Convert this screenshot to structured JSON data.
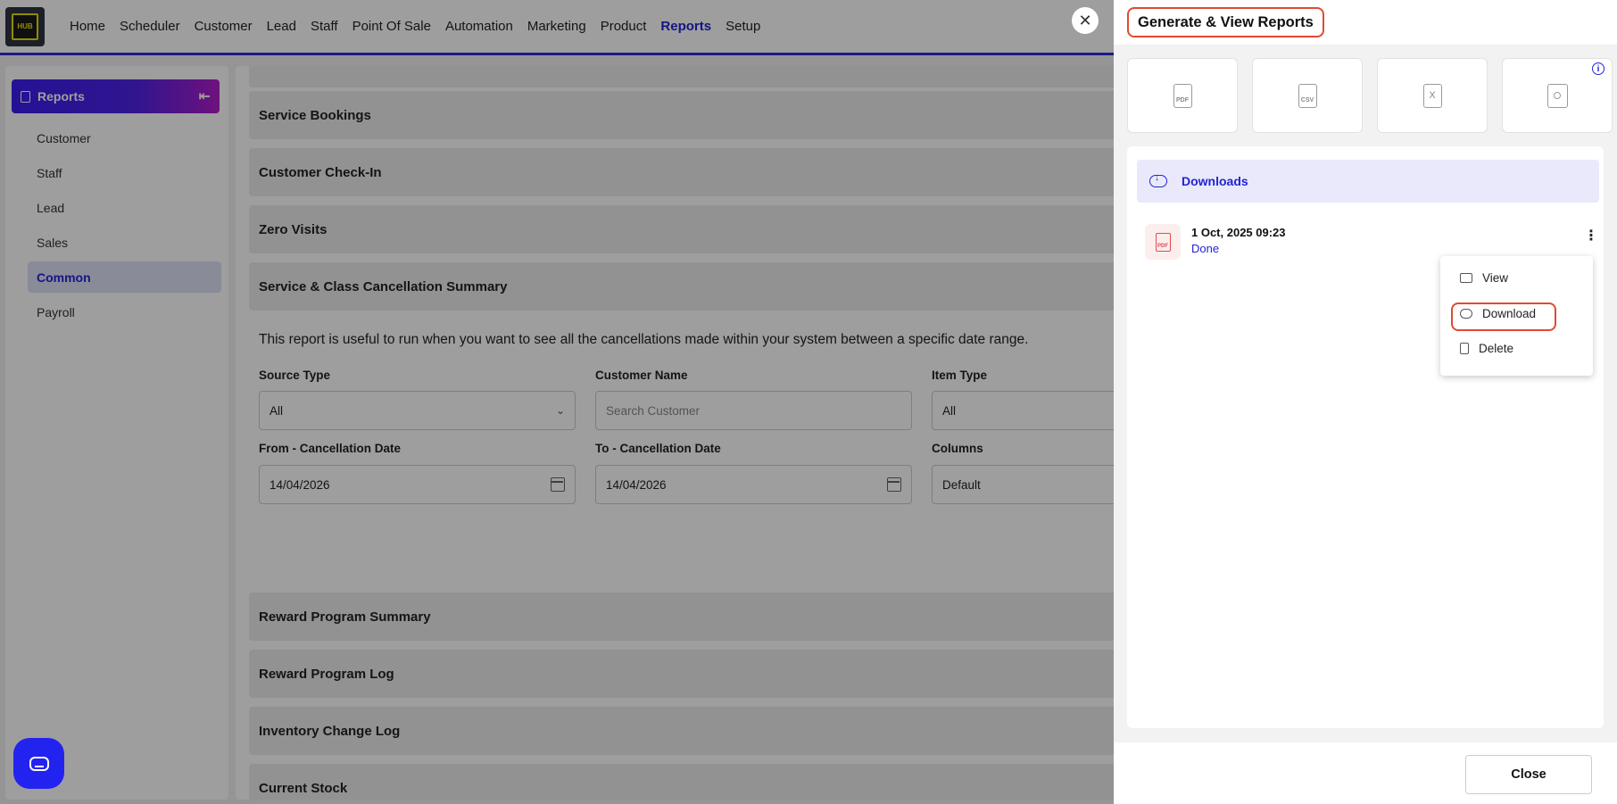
{
  "logo": {
    "text": "HUB"
  },
  "nav": {
    "items": [
      "Home",
      "Scheduler",
      "Customer",
      "Lead",
      "Staff",
      "Point Of Sale",
      "Automation",
      "Marketing",
      "Product",
      "Reports",
      "Setup"
    ],
    "active": "Reports"
  },
  "sidebar": {
    "title": "Reports",
    "items": [
      "Customer",
      "Staff",
      "Lead",
      "Sales",
      "Common",
      "Payroll"
    ],
    "active": "Common"
  },
  "main": {
    "sections_top": [
      "Service Bookings",
      "Customer Check-In",
      "Zero Visits",
      "Service & Class Cancellation Summary"
    ],
    "description": "This report is useful to run when you want to see all the cancellations made within your system between a specific date range.",
    "fields": {
      "source_type": {
        "label": "Source Type",
        "value": "All"
      },
      "customer_name": {
        "label": "Customer Name",
        "placeholder": "Search Customer"
      },
      "item_type": {
        "label": "Item Type",
        "value": "All"
      },
      "from_date": {
        "label": "From - Cancellation Date",
        "value": "14/04/2026"
      },
      "to_date": {
        "label": "To - Cancellation Date",
        "value": "14/04/2026"
      },
      "columns": {
        "label": "Columns",
        "value": "Default"
      }
    },
    "sections_bottom": [
      "Reward Program Summary",
      "Reward Program Log",
      "Inventory Change Log",
      "Current Stock"
    ]
  },
  "panel": {
    "title": "Generate & View Reports",
    "formats": [
      {
        "icon": "pdf-file-icon",
        "label": "PDF"
      },
      {
        "icon": "csv-file-icon",
        "label": "CSV"
      },
      {
        "icon": "excel-file-icon",
        "label": "X"
      },
      {
        "icon": "contact-file-icon",
        "label": ""
      }
    ],
    "downloads_label": "Downloads",
    "file": {
      "date": "1 Oct, 2025 09:23",
      "status": "Done",
      "type_badge": "PDF"
    },
    "menu": {
      "view": "View",
      "download": "Download",
      "delete": "Delete"
    },
    "close_label": "Close"
  },
  "colors": {
    "accent": "#2323d6",
    "highlight": "#e04a32"
  }
}
